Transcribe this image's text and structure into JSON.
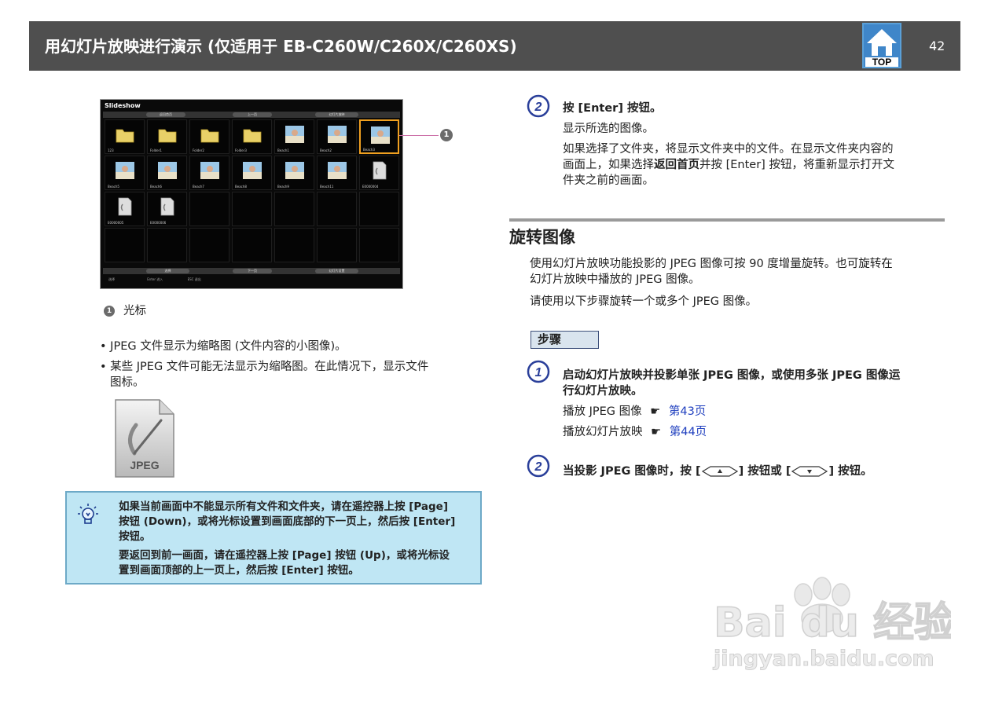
{
  "header": {
    "title": "用幻灯片放映进行演示 (仅适用于 EB-C260W/C260X/C260XS)",
    "top_label": "TOP",
    "page_number": "42"
  },
  "slideshow": {
    "title": "Slideshow",
    "toolbar_top": [
      "返回首页",
      "上一页",
      "幻灯片放映"
    ],
    "toolbar_bottom": [
      "选择",
      "下一页",
      "幻灯片设置"
    ],
    "footer": [
      "选择",
      "Enter 进入",
      "ESC 退出"
    ],
    "items": [
      {
        "label": "123",
        "kind": "folder"
      },
      {
        "label": "Folder1",
        "kind": "folder"
      },
      {
        "label": "Folder2",
        "kind": "folder"
      },
      {
        "label": "Folder3",
        "kind": "folder"
      },
      {
        "label": "Beach1",
        "kind": "photo"
      },
      {
        "label": "Beach2",
        "kind": "photo"
      },
      {
        "label": "Beach3",
        "kind": "photo"
      },
      {
        "label": "Beach5",
        "kind": "photo"
      },
      {
        "label": "Beach6",
        "kind": "photo"
      },
      {
        "label": "Beach7",
        "kind": "photo"
      },
      {
        "label": "Beach8",
        "kind": "photo"
      },
      {
        "label": "Beach9",
        "kind": "photo"
      },
      {
        "label": "Beach11",
        "kind": "photo"
      },
      {
        "label": "E0000004",
        "kind": "jpeg"
      },
      {
        "label": "E0000005",
        "kind": "jpeg"
      },
      {
        "label": "E0000006",
        "kind": "jpeg"
      }
    ]
  },
  "callout": {
    "number": "1",
    "label": "光标"
  },
  "bullets": [
    "JPEG 文件显示为缩略图 (文件内容的小图像)。",
    "某些 JPEG 文件可能无法显示为缩略图。在此情况下，显示文件",
    "图标。"
  ],
  "jpeg_icon_label": "JPEG",
  "tip": {
    "lines_1": [
      "如果当前画面中不能显示所有文件和文件夹，请在遥控器上按 [Page]",
      "按钮 (Down)，或将光标设置到画面底部的下一页上，然后按 [Enter]",
      "按钮。"
    ],
    "lines_2": [
      "要返回到前一画面，请在遥控器上按 [Page] 按钮 (Up)，或将光标设",
      "置到画面顶部的上一页上，然后按 [Enter] 按钮。"
    ]
  },
  "step2_top": {
    "number": "2",
    "title": "按 [Enter] 按钮。",
    "line1": "显示所选的图像。",
    "desc": [
      "如果选择了文件夹，将显示文件夹中的文件。在显示文件夹内容的",
      "件夹之前的画面。"
    ],
    "desc_mid_before": "画面上，如果选择",
    "desc_mid_bold": "返回首页",
    "desc_mid_after": "并按 [Enter] 按钮，将重新显示打开文"
  },
  "section": {
    "heading": "旋转图像",
    "para1": [
      "使用幻灯片放映功能投影的 JPEG 图像可按 90 度增量旋转。也可旋转在",
      "幻灯片放映中播放的 JPEG 图像。"
    ],
    "para2": "请使用以下步骤旋转一个或多个 JPEG 图像。",
    "steps_label": "步骤"
  },
  "step1": {
    "number": "1",
    "title": [
      "启动幻灯片放映并投影单张 JPEG 图像，或使用多张 JPEG 图像运",
      "行幻灯片放映。"
    ],
    "ref1_text": "播放 JPEG 图像",
    "ref1_link": "第43页",
    "ref2_text": "播放幻灯片放映",
    "ref2_link": "第44页",
    "pointer": "☛"
  },
  "step2": {
    "number": "2",
    "before": "当投影 JPEG 图像时，按 [",
    "middle": "] 按钮或 [",
    "after": "] 按钮。"
  },
  "watermark": {
    "brand": "Bai du 经验",
    "url": "jingyan.baidu.com"
  }
}
